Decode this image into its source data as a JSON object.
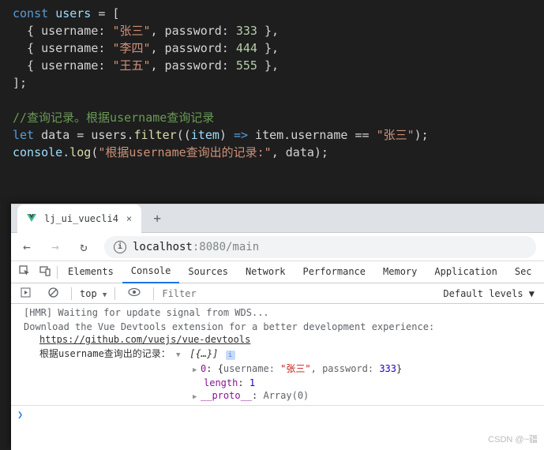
{
  "code": {
    "l1": "const users = [",
    "l2a": "  { username: ",
    "l2s": "\"张三\"",
    "l2b": ", password: ",
    "l2n": "333",
    "l2c": " },",
    "l3a": "  { username: ",
    "l3s": "\"李四\"",
    "l3b": ", password: ",
    "l3n": "444",
    "l3c": " },",
    "l4a": "  { username: ",
    "l4s": "\"王五\"",
    "l4b": ", password: ",
    "l4n": "555",
    "l4c": " },",
    "l5": "];",
    "l7": "//查询记录。根据username查询记录",
    "l8a": "let",
    "l8b": " data = users.",
    "l8f": "filter",
    "l8c": "((",
    "l8d": "item",
    "l8e": ") ",
    "l8ar": "=>",
    "l8g": " item.username == ",
    "l8s": "\"张三\"",
    "l8h": ");",
    "l9a": "console.",
    "l9f": "log",
    "l9b": "(",
    "l9s": "\"根据username查询出的记录:\"",
    "l9c": ", data);"
  },
  "browser": {
    "tab": {
      "title": "lj_ui_vuecli4",
      "close": "×"
    },
    "newtab": "+",
    "nav": {
      "back": "←",
      "forward": "→",
      "reload": "↻"
    },
    "url": {
      "host": "localhost",
      "rest": ":8080/main"
    }
  },
  "devtools": {
    "tabs": {
      "elements": "Elements",
      "console": "Console",
      "sources": "Sources",
      "network": "Network",
      "performance": "Performance",
      "memory": "Memory",
      "application": "Application",
      "sec": "Sec"
    },
    "toolbar": {
      "context": "top",
      "filter_ph": "Filter",
      "levels": "Default levels ▼"
    },
    "logs": {
      "hmr": "[HMR] Waiting for update signal from WDS...",
      "vue1": "Download the Vue Devtools extension for a better development experience:",
      "vue2": "https://github.com/vuejs/vue-devtools",
      "result_label": "根据username查询出的记录：",
      "arr_preview": "[{…}]",
      "row0_idx": "0",
      "row0_obj": "{",
      "row0_u": "\"张三\"",
      "row0_p": "333",
      "row0_close": "}",
      "row0_u_lbl": "username: ",
      "row0_p_lbl": ", password: ",
      "length_lbl": "length",
      "length_val": "1",
      "proto_lbl": "__proto__",
      "proto_val": "Array(0)"
    }
  },
  "watermark": "CSDN @~疆"
}
